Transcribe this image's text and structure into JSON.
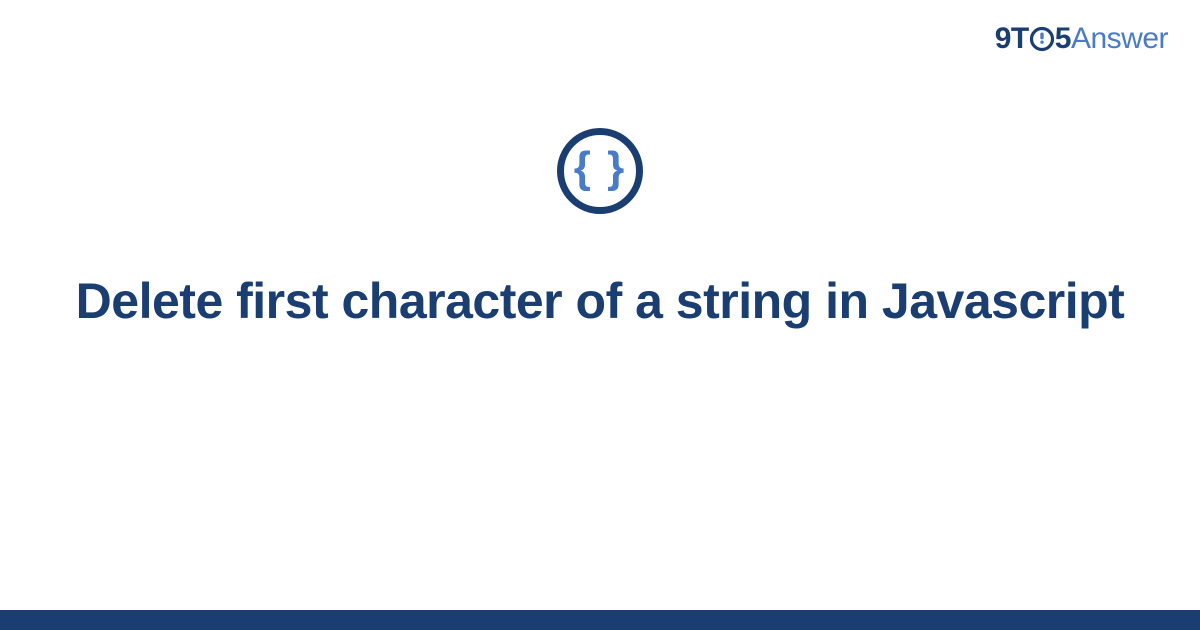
{
  "brand": {
    "part_9t": "9T",
    "part_5": "5",
    "part_answer": "Answer"
  },
  "icon": {
    "glyph": "{ }",
    "semantic": "code-braces-icon"
  },
  "title": "Delete first character of a string in Javascript",
  "colors": {
    "primary_dark": "#1a3e72",
    "primary_light": "#4a7bc8",
    "background": "#ffffff"
  }
}
